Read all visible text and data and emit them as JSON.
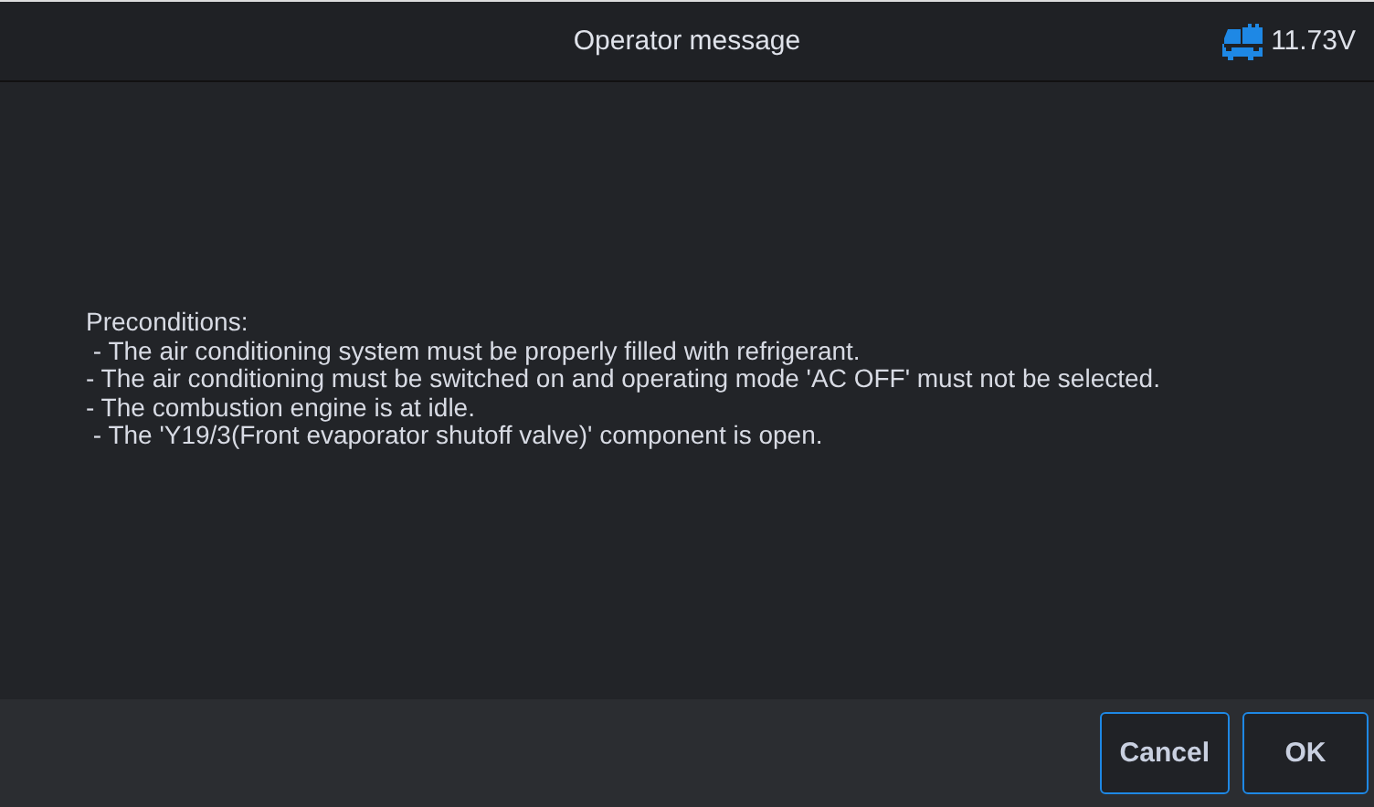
{
  "header": {
    "title": "Operator message",
    "voltage": "11.73V"
  },
  "message": {
    "lines": [
      "Preconditions:",
      " - The air conditioning system must be properly filled with refrigerant.",
      "- The air conditioning must be switched on and operating mode 'AC OFF' must not be selected.",
      "- The combustion engine is at idle.",
      " - The 'Y19/3(Front evaporator shutoff valve)' component is open."
    ]
  },
  "buttons": [
    "Cancel",
    "OK"
  ]
}
